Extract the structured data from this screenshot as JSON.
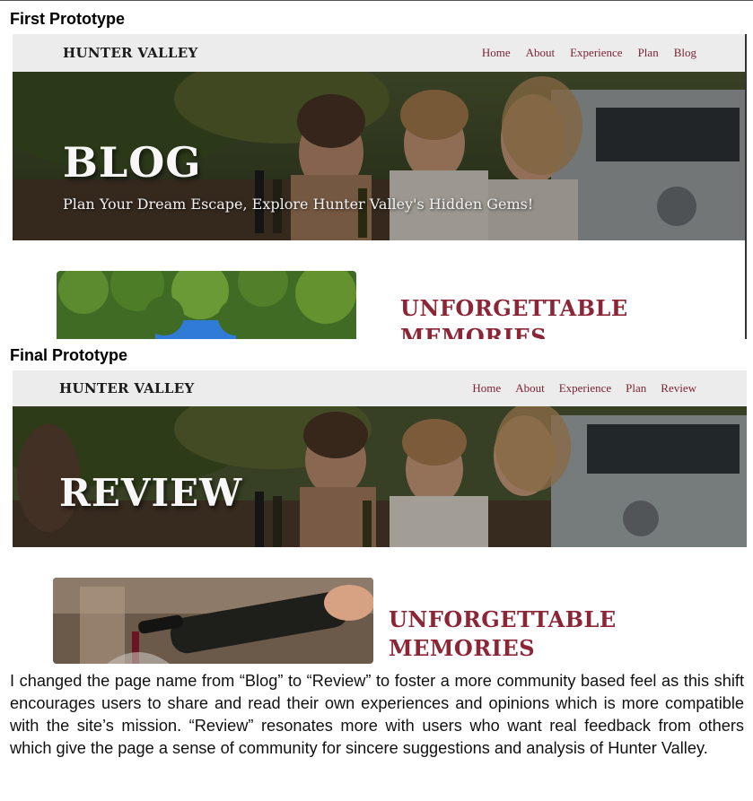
{
  "sections": {
    "first_label": "First Prototype",
    "final_label": "Final Prototype"
  },
  "first_prototype": {
    "brand": "HUNTER VALLEY",
    "nav": [
      "Home",
      "About",
      "Experience",
      "Plan",
      "Blog"
    ],
    "hero_title": "BLOG",
    "hero_subtitle": "Plan Your Dream Escape, Explore Hunter Valley's Hidden Gems!",
    "card_heading_line1": "UNFORGETTABLE",
    "card_heading_line2": "MEMORIES"
  },
  "final_prototype": {
    "brand": "HUNTER VALLEY",
    "nav": [
      "Home",
      "About",
      "Experience",
      "Plan",
      "Review"
    ],
    "hero_title": "REVIEW",
    "card_heading_line1": "UNFORGETTABLE",
    "card_heading_line2": "MEMORIES"
  },
  "caption": "I changed the page name from “Blog” to “Review” to foster a more community based feel as this shift encourages users to share and read their own experiences and opinions which is more compatible with the site’s mission. “Review” resonates more with users who want real feedback from others which give the page a sense of community for sincere suggestions and analysis of Hunter Valley.",
  "colors": {
    "accent": "#8b2637",
    "nav_link": "#7a2433",
    "nav_bg": "#ececec"
  }
}
